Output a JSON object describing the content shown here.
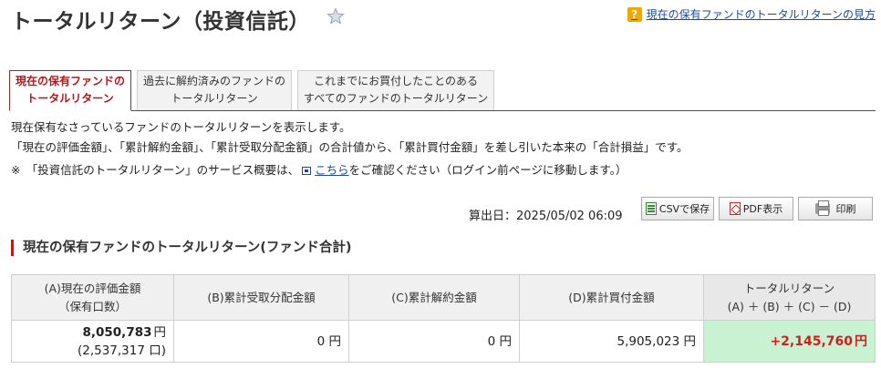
{
  "page": {
    "title": "トータルリターン（投資信託）",
    "star_icon": "star-icon",
    "help_link": "現在の保有ファンドのトータルリターンの見方",
    "help_icon": "question-icon"
  },
  "tabs": [
    {
      "line1": "現在の保有ファンドの",
      "line2": "トータルリターン",
      "active": true
    },
    {
      "line1": "過去に解約済みのファンドの",
      "line2": "トータルリターン",
      "active": false
    },
    {
      "line1": "これまでにお買付したことのある",
      "line2": "すべてのファンドのトータルリターン",
      "active": false
    }
  ],
  "description": {
    "line1": "現在保有なさっているファンドのトータルリターンを表示します。",
    "line2": "「現在の評価金額」、「累計解約金額」、「累計受取分配金額」の合計値から、「累計買付金額」を差し引いた本来の「合計損益」です。",
    "line3_prefix": "※　「投資信託のトータルリターン」のサービス概要は、",
    "line3_link": "こちら",
    "line3_suffix": "をご確認ください（ログイン前ページに移動します。）"
  },
  "toolbar": {
    "calc_date": "算出日：2025/05/02 06:09",
    "csv_label": "CSVで保存",
    "pdf_label": "PDF表示",
    "print_label": "印刷"
  },
  "section": {
    "title": "現在の保有ファンドのトータルリターン(ファンド合計)"
  },
  "table": {
    "headers": {
      "a_line1": "(A)現在の評価金額",
      "a_line2": "（保有口数）",
      "b": "(B)累計受取分配金額",
      "c": "(C)累計解約金額",
      "d": "(D)累計買付金額",
      "total_line1": "トータルリターン",
      "total_line2": "(A) ＋ (B) ＋ (C) － (D)"
    },
    "row": {
      "a_amount": "8,050,783",
      "a_unit": "円",
      "a_units": "(2,537,317 口)",
      "b": "0 円",
      "c": "0 円",
      "d": "5,905,023 円",
      "total_amount": "+2,145,760",
      "total_unit": "円"
    }
  },
  "colors": {
    "accent_red": "#c11a1a",
    "link_blue": "#1a4a9c",
    "total_bg": "#c9f2d2",
    "total_text": "#d21e1e"
  }
}
